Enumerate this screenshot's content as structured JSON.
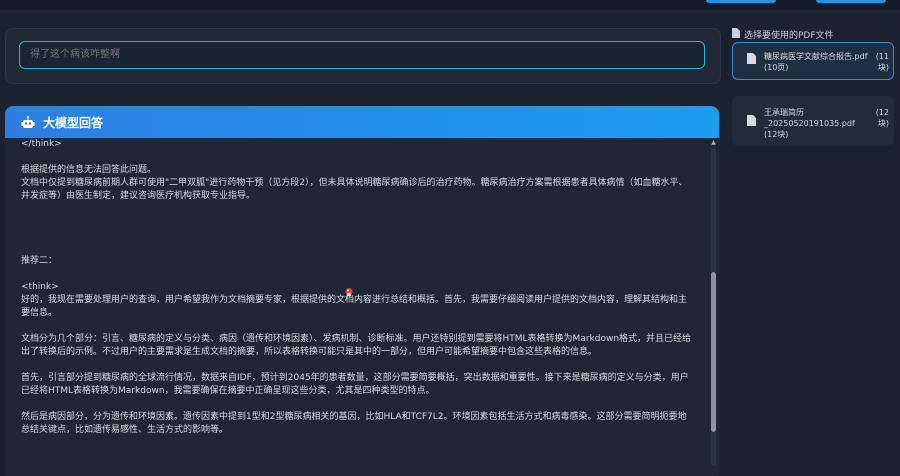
{
  "question": {
    "placeholder": "得了这个病该咋整啊"
  },
  "answer_panel": {
    "icon": "robot-icon",
    "title": "大模型回答",
    "paragraphs": [
      "</think>",
      "",
      "根据提供的信息无法回答此问题。",
      "文档中仅提到糖尿病前期人群可使用\"二甲双胍\"进行药物干预（见方段2），但未具体说明糖尿病确诊后的治疗药物。糖尿病治疗方案需根据患者具体病情（如血糖水平、并发症等）由医生制定，建议咨询医疗机构获取专业指导。",
      "",
      "",
      "",
      "",
      "推荐二：",
      "",
      "<think>",
      "好的，我现在需要处理用户的查询，用户希望我作为文档摘要专家，根据提供的文档内容进行总结和概括。首先，我需要仔细阅读用户提供的文档内容，理解其结构和主要信息。",
      "",
      "文档分为几个部分：引言、糖尿病的定义与分类、病因（遗传和环境因素）、发病机制、诊断标准。用户还特别提到需要将HTML表格转换为Markdown格式，并且已经给出了转换后的示例。不过用户的主要需求是生成文档的摘要，所以表格转换可能只是其中的一部分，但用户可能希望摘要中包含这些表格的信息。",
      "",
      "首先，引言部分提到糖尿病的全球流行情况，数据来自IDF，预计到2045年的患者数量，这部分需要简要概括，突出数据和重要性。接下来是糖尿病的定义与分类，用户已经将HTML表格转换为Markdown，我需要确保在摘要中正确呈现这些分类，尤其是四种类型的特点。",
      "",
      "然后是病因部分，分为遗传和环境因素。遗传因素中提到1型和2型糖尿病相关的基因，比如HLA和TCF7L2。环境因素包括生活方式和病毒感染。这部分需要简明扼要地总结关键点，比如遗传易感性、生活方式的影响等。"
    ]
  },
  "sidebar": {
    "icon": "file-icon",
    "title": "选择要使用的PDF文件",
    "files": [
      {
        "name": "糖尿病医学文献综合报告.pdf (10页)",
        "size": "(11 块)",
        "selected": true
      },
      {
        "name": "王承瑞简历_20250520191035.pdf (12块)",
        "size": "(12 块)",
        "selected": false
      }
    ]
  },
  "colors": {
    "accent": "#2b8fe0",
    "header_gradient_start": "#2c7fe0",
    "header_gradient_end": "#1c9df0",
    "input_border": "#2fb3d6",
    "background": "#1b2331"
  }
}
